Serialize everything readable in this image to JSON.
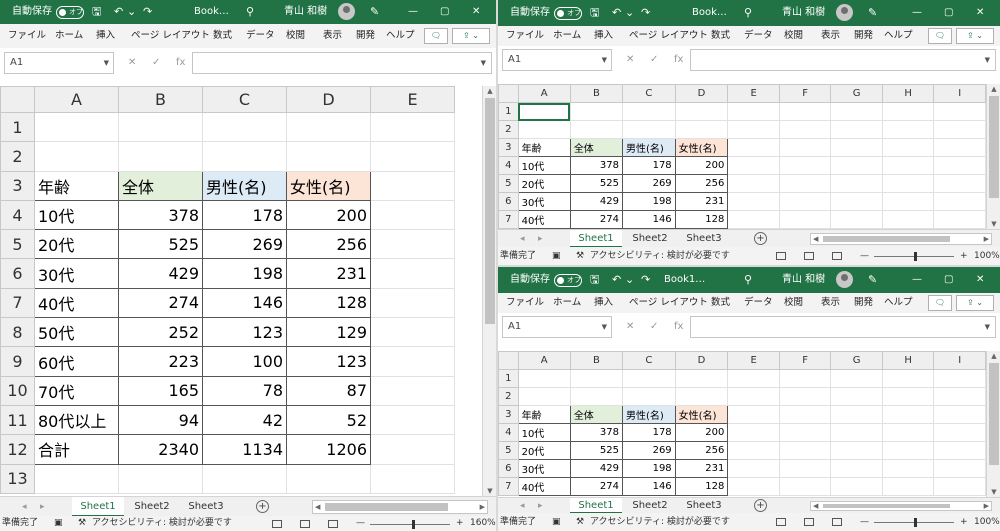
{
  "title_bar": {
    "autosave_label": "自動保存",
    "autosave_state": "オフ",
    "filename_main": "Book…",
    "filename_bottom": "Book1…",
    "user_name": "青山 和樹",
    "minimize": "—",
    "maximize": "▢",
    "close": "✕"
  },
  "ribbon_tabs": [
    "ファイル",
    "ホーム",
    "挿入",
    "ページ レイアウト",
    "数式",
    "データ",
    "校閲",
    "表示",
    "開発",
    "ヘルプ"
  ],
  "formula_bar": {
    "name_box": "A1",
    "cancel": "✕",
    "enter": "✓",
    "fx": "fx",
    "formula": ""
  },
  "columns": [
    "A",
    "B",
    "C",
    "D",
    "E",
    "F",
    "G",
    "H",
    "I"
  ],
  "rows": [
    [
      "",
      "",
      "",
      ""
    ],
    [
      "",
      "",
      "",
      ""
    ],
    [
      "年齢",
      "全体",
      "男性(名)",
      "女性(名)"
    ],
    [
      "10代",
      "378",
      "178",
      "200"
    ],
    [
      "20代",
      "525",
      "269",
      "256"
    ],
    [
      "30代",
      "429",
      "198",
      "231"
    ],
    [
      "40代",
      "274",
      "146",
      "128"
    ],
    [
      "50代",
      "252",
      "123",
      "129"
    ],
    [
      "60代",
      "223",
      "100",
      "123"
    ],
    [
      "70代",
      "165",
      "78",
      "87"
    ],
    [
      "80代以上",
      "94",
      "42",
      "52"
    ],
    [
      "合計",
      "2340",
      "1134",
      "1206"
    ],
    [
      "",
      "",
      "",
      ""
    ]
  ],
  "sheet_tabs": [
    "Sheet1",
    "Sheet2",
    "Sheet3"
  ],
  "status_bar": {
    "ready": "準備完了",
    "accessibility": "アクセシビリティ: 検討が必要です",
    "zoom_main": "160%",
    "zoom_small": "100%",
    "zoom_minus": "—",
    "zoom_plus": "+"
  },
  "colors": {
    "title_bar": "#217346",
    "header_fill_total": "#e2efda",
    "header_fill_male": "#ddebf7",
    "header_fill_female": "#fce4d6"
  }
}
